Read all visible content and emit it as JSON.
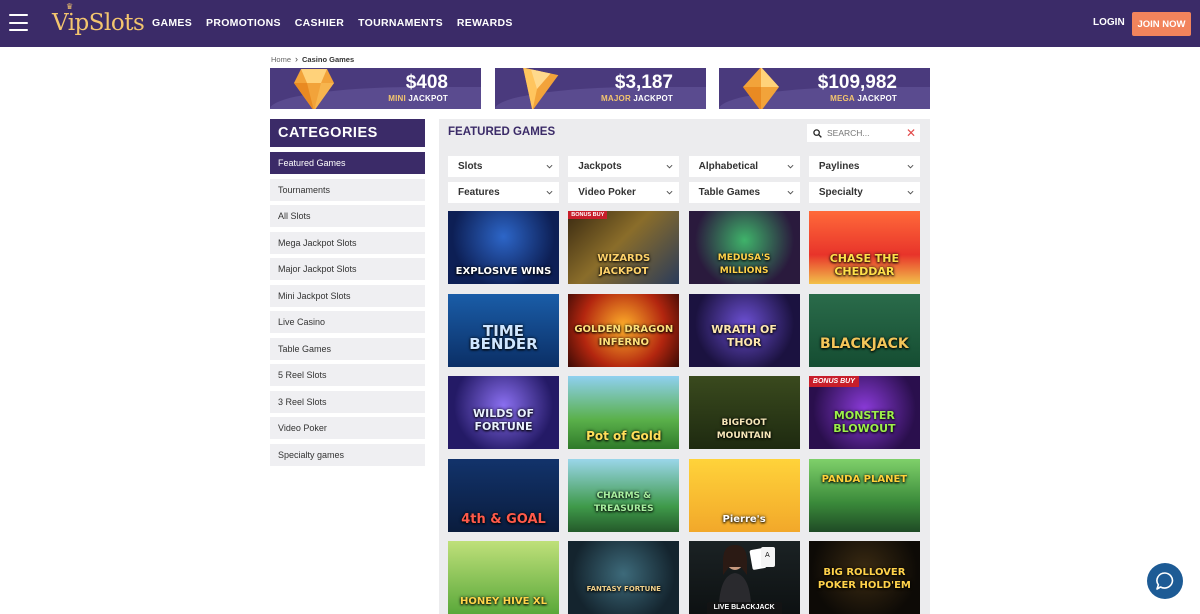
{
  "header": {
    "logo": "VipSlots",
    "nav": [
      "GAMES",
      "PROMOTIONS",
      "CASHIER",
      "TOURNAMENTS",
      "REWARDS"
    ],
    "login": "LOGIN",
    "join": "JOIN NOW",
    "bg_color": "#3b2b68",
    "join_color": "#f2845c"
  },
  "breadcrumb": {
    "home": "Home",
    "current": "Casino Games"
  },
  "jackpots": [
    {
      "amount": "$408",
      "tier": "MINI",
      "word": "JACKPOT",
      "icon": "gem-icon"
    },
    {
      "amount": "$3,187",
      "tier": "MAJOR",
      "word": "JACKPOT",
      "icon": "gem-icon"
    },
    {
      "amount": "$109,982",
      "tier": "MEGA",
      "word": "JACKPOT",
      "icon": "gem-icon"
    }
  ],
  "sidebar": {
    "title": "CATEGORIES",
    "items": [
      "Featured Games",
      "Tournaments",
      "All Slots",
      "Mega Jackpot Slots",
      "Major Jackpot Slots",
      "Mini Jackpot Slots",
      "Live Casino",
      "Table Games",
      "5 Reel Slots",
      "3 Reel Slots",
      "Video Poker",
      "Specialty games"
    ],
    "active": "Featured Games"
  },
  "main": {
    "title": "FEATURED GAMES",
    "search_placeholder": "SEARCH...",
    "filters": [
      "Slots",
      "Jackpots",
      "Alphabetical",
      "Paylines",
      "Features",
      "Video Poker",
      "Table Games",
      "Specialty"
    ],
    "games": [
      {
        "title": "EXPLOSIVE WINS",
        "badge": ""
      },
      {
        "title": "WIZARDS JACKPOT",
        "badge": "BONUS BUY"
      },
      {
        "title": "MEDUSA'S MILLIONS",
        "badge": ""
      },
      {
        "title": "CHASE THE CHEDDAR",
        "badge": ""
      },
      {
        "title": "TIME BENDER",
        "badge": ""
      },
      {
        "title": "GOLDEN DRAGON INFERNO",
        "badge": ""
      },
      {
        "title": "WRATH OF THOR",
        "badge": ""
      },
      {
        "title": "BLACKJACK",
        "badge": ""
      },
      {
        "title": "WILDS OF FORTUNE",
        "badge": ""
      },
      {
        "title": "Pot of Gold",
        "badge": ""
      },
      {
        "title": "BIGFOOT MOUNTAIN",
        "badge": ""
      },
      {
        "title": "MONSTER BLOWOUT",
        "badge": "BONUS BUY"
      },
      {
        "title": "4th & GOAL",
        "badge": ""
      },
      {
        "title": "CHARMS & TREASURES",
        "badge": ""
      },
      {
        "title": "Pierre's",
        "badge": ""
      },
      {
        "title": "PANDA PLANET",
        "badge": ""
      },
      {
        "title": "HONEY HIVE XL",
        "badge": ""
      },
      {
        "title": "FANTASY FORTUNE",
        "badge": ""
      },
      {
        "title": "",
        "badge": "",
        "live": "LIVE BLACKJACK"
      },
      {
        "title": "BIG ROLLOVER POKER HOLD'EM",
        "badge": ""
      }
    ]
  }
}
